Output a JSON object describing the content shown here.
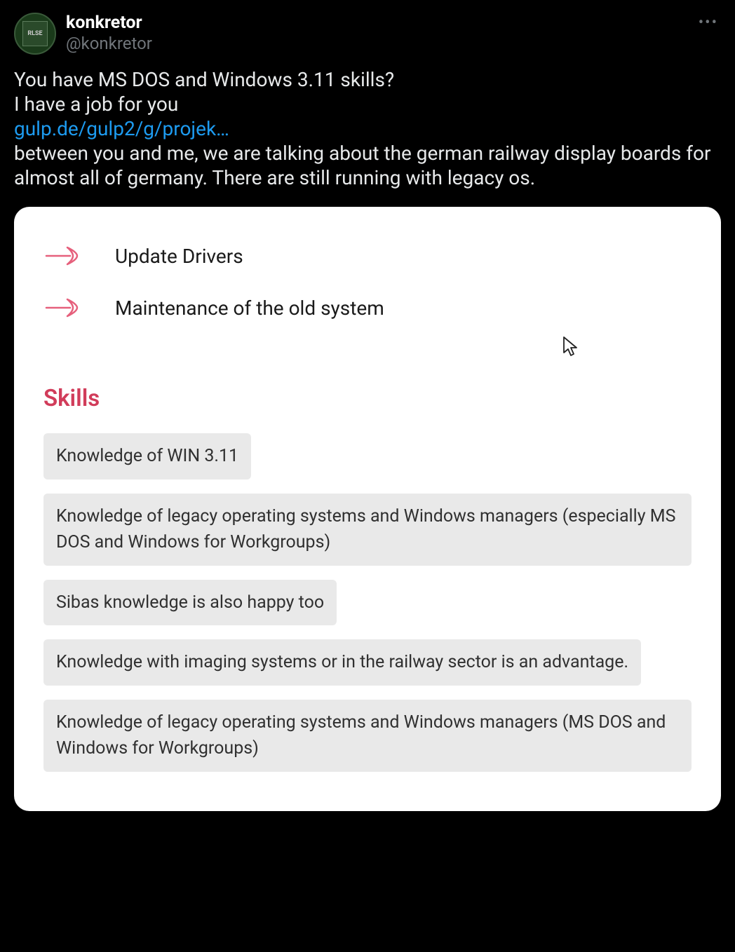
{
  "tweet": {
    "user": {
      "display_name": "konkretor",
      "handle": "@konkretor",
      "avatar_badge": "RLSE"
    },
    "body": {
      "line1": "You have MS DOS and Windows 3.11 skills?",
      "line2": "I have a job for you",
      "link": "gulp.de/gulp2/g/projek…",
      "line3": "between you and me, we are talking about the german railway display boards for almost all of germany. There are still running with legacy os."
    }
  },
  "card": {
    "tasks": [
      "Update Drivers",
      "Maintenance of the old system"
    ],
    "skills_heading": "Skills",
    "skills": [
      "Knowledge of WIN 3.11",
      "Knowledge of legacy operating systems and Windows managers (especially MS DOS and Windows for Workgroups)",
      "Sibas knowledge is also happy too",
      "Knowledge with imaging systems or in the railway sector is an advantage.",
      "Knowledge of legacy operating systems and Windows managers (MS DOS and Windows for Workgroups)"
    ]
  },
  "colors": {
    "link": "#1d9bf0",
    "accent": "#d13c5a",
    "chip_bg": "#e9e9e9"
  }
}
